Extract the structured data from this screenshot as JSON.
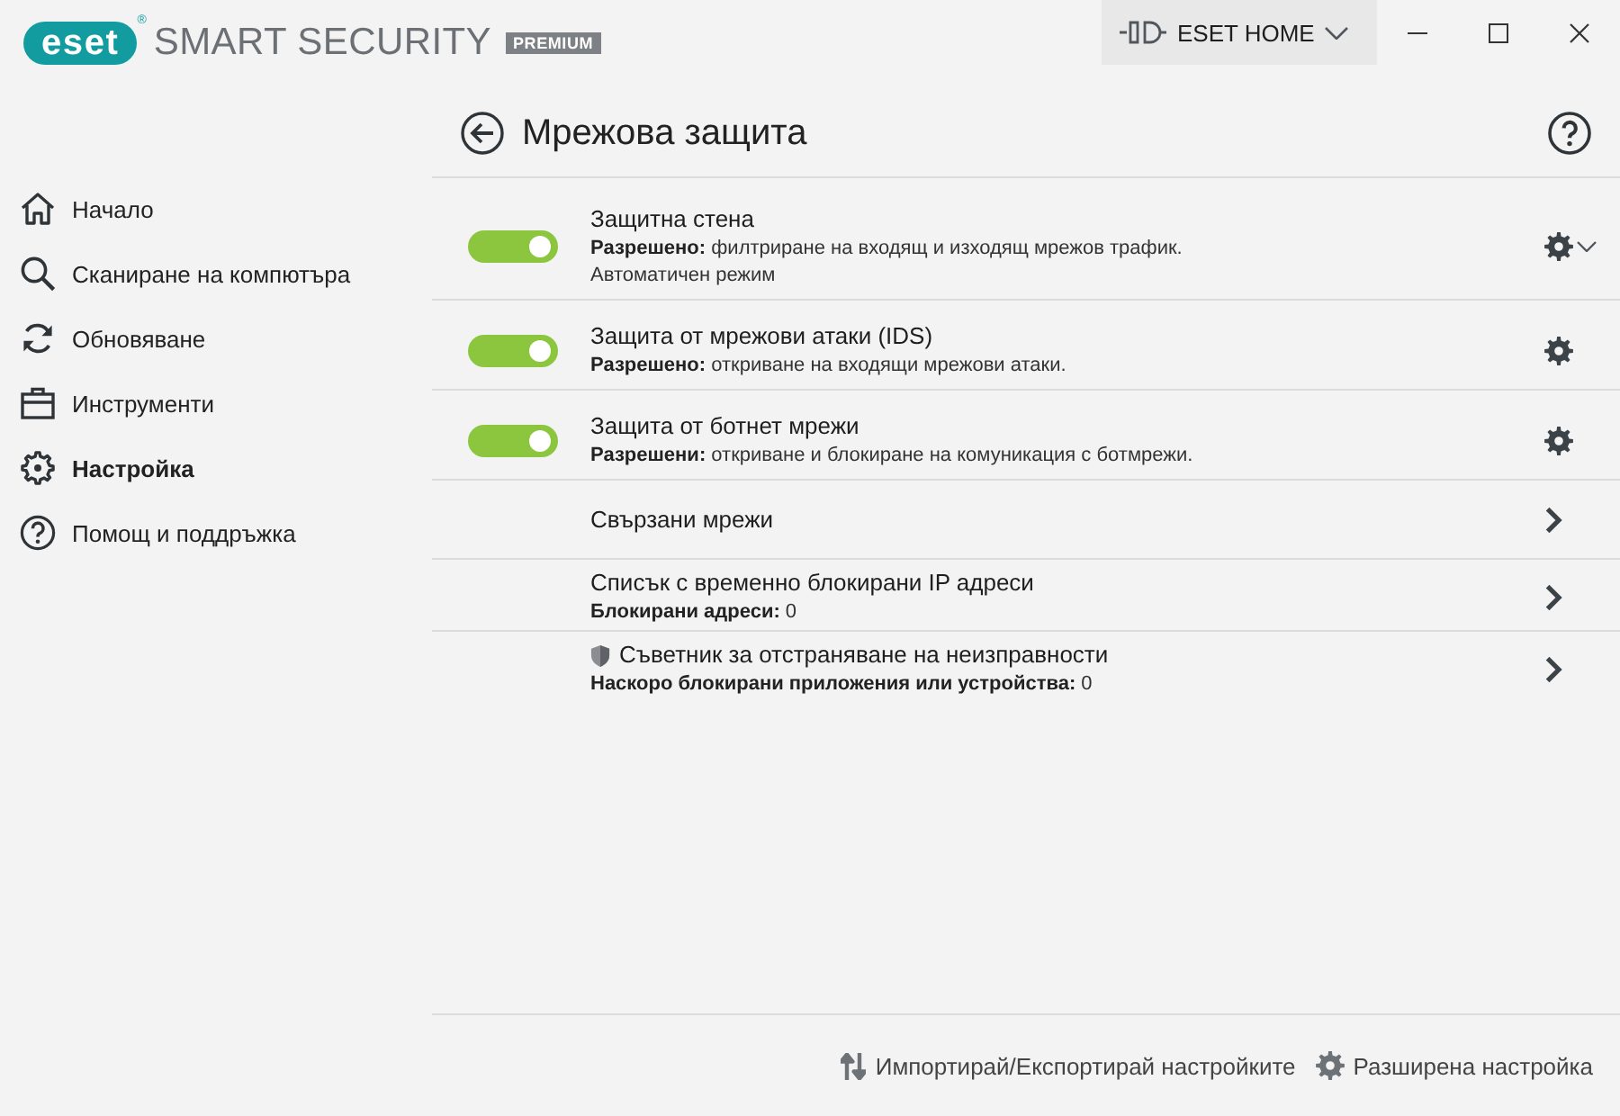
{
  "header": {
    "logo": "eset",
    "registered": "®",
    "product": "SMART SECURITY",
    "edition": "PREMIUM",
    "account_button": "ESET HOME"
  },
  "sidebar": {
    "items": [
      {
        "label": "Начало",
        "selected": false
      },
      {
        "label": "Сканиране на компютъра",
        "selected": false
      },
      {
        "label": "Обновяване",
        "selected": false
      },
      {
        "label": "Инструменти",
        "selected": false
      },
      {
        "label": "Настройка",
        "selected": true
      },
      {
        "label": "Помощ и поддръжка",
        "selected": false
      }
    ]
  },
  "page": {
    "title": "Мрежова защита"
  },
  "rows": [
    {
      "kind": "toggle",
      "title": "Защитна стена",
      "on": true,
      "description": "**Разрешено:** филтриране на входящ и изходящ мрежов трафик.",
      "note": "Автоматичен режим",
      "dropdown": true
    },
    {
      "kind": "toggle",
      "title": "Защита от мрежови атаки (IDS)",
      "on": true,
      "description": "**Разрешено:** откриване на входящи мрежови атаки.",
      "dropdown": false
    },
    {
      "kind": "toggle",
      "title": "Защита от ботнет мрежи",
      "on": true,
      "description": "**Разрешени:** откриване и блокиране на комуникация с ботмрежи.",
      "dropdown": false
    },
    {
      "kind": "link",
      "title": "Свързани мрежи"
    },
    {
      "kind": "link",
      "title": "Списък с временно блокирани IP адреси",
      "description": "**Блокирани адреси:** 0"
    },
    {
      "kind": "shielded",
      "title": "Съветник за отстраняване на неизправности",
      "description": "**Наскоро блокирани приложения или устройства:** 0"
    }
  ],
  "footer": {
    "links": [
      "Импортирай/Експортирай настройките",
      "Разширена настройка"
    ]
  }
}
